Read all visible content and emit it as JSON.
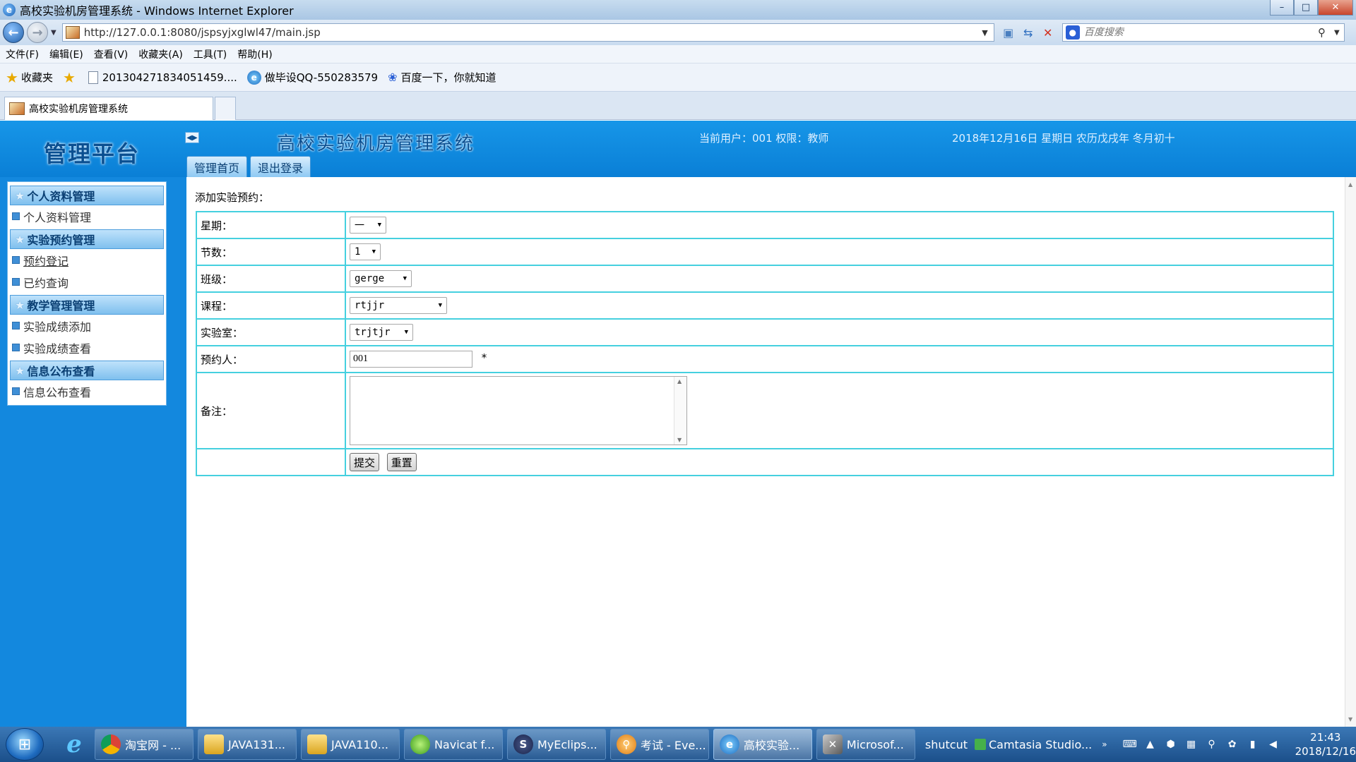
{
  "window": {
    "title": "高校实验机房管理系统 - Windows Internet Explorer",
    "controls": {
      "minimize": "–",
      "maximize": "□",
      "close": "✕"
    }
  },
  "addressbar": {
    "url": "http://127.0.0.1:8080/jspsyjxglwl47/main.jsp",
    "search_placeholder": "百度搜索"
  },
  "menubar": [
    "文件(F)",
    "编辑(E)",
    "查看(V)",
    "收藏夹(A)",
    "工具(T)",
    "帮助(H)"
  ],
  "favorites": {
    "label": "收藏夹",
    "items": [
      "20130427183405​1459....",
      "做毕设QQ-550283579",
      "百度一下，你就知道"
    ]
  },
  "tab": {
    "title": "高校实验机房管理系统"
  },
  "page": {
    "brand": "管理平台",
    "system_title": "高校实验机房管理系统",
    "user_info": "当前用户：001 权限：教师",
    "date_info": "2018年12月16日 星期日 农历戊戌年 冬月初十",
    "top_nav": [
      "管理首页",
      "退出登录"
    ],
    "sidebar": {
      "groups": [
        {
          "title": "个人资料管理",
          "items": [
            "个人资料管理"
          ]
        },
        {
          "title": "实验预约管理",
          "items": [
            "预约登记",
            "已约查询"
          ]
        },
        {
          "title": "教学管理管理",
          "items": [
            "实验成绩添加",
            "实验成绩查看"
          ]
        },
        {
          "title": "信息公布查看",
          "items": [
            "信息公布查看"
          ]
        }
      ]
    },
    "form": {
      "caption": "添加实验预约：",
      "weekday_label": "星期：",
      "weekday_value": "一",
      "section_label": "节数：",
      "section_value": "1",
      "class_label": "班级：",
      "class_value": "gerge",
      "course_label": "课程：",
      "course_value": "rtjjr",
      "lab_label": "实验室：",
      "lab_value": "trjtjr",
      "booker_label": "预约人：",
      "booker_value": "001",
      "required_mark": "*",
      "note_label": "备注：",
      "note_value": "",
      "submit_label": "提交",
      "reset_label": "重置"
    }
  },
  "taskbar": {
    "tasks": [
      {
        "label": "淘宝网 - ...",
        "icon": "chrome-icon"
      },
      {
        "label": "JAVA131...",
        "icon": "folder-icon"
      },
      {
        "label": "JAVA110...",
        "icon": "folder-icon"
      },
      {
        "label": "Navicat f...",
        "icon": "navicat-icon"
      },
      {
        "label": "MyEclips...",
        "icon": "eclipse-icon"
      },
      {
        "label": "考试 - Eve...",
        "icon": "search-icon"
      },
      {
        "label": "高校实验...",
        "icon": "ie-icon"
      },
      {
        "label": "Microsof...",
        "icon": "tools-icon"
      }
    ],
    "shutcut": "shutcut",
    "camtasia": "Camtasia Studio...",
    "more": "»",
    "time": "21:43",
    "date": "2018/12/16"
  }
}
